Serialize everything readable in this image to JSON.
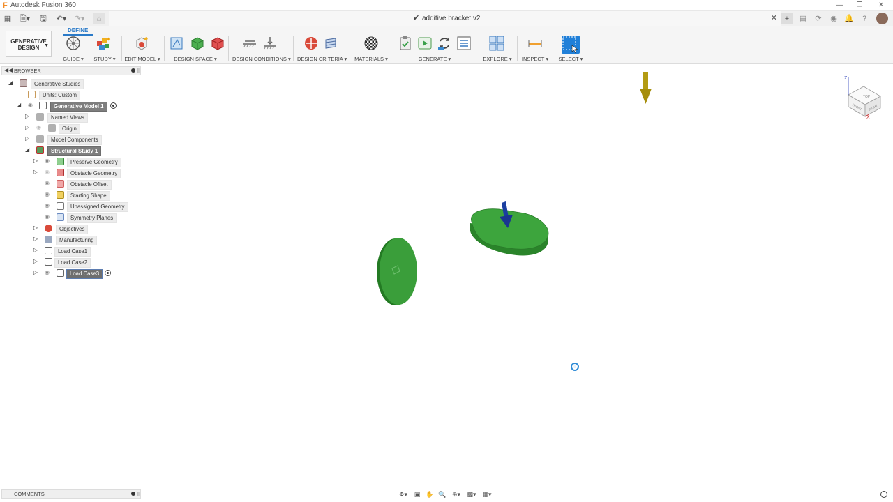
{
  "window": {
    "app_title": "Autodesk Fusion 360",
    "doc_title": "additive bracket v2"
  },
  "workspace": {
    "label_line1": "GENERATIVE",
    "label_line2": "DESIGN"
  },
  "ribbon": {
    "active_tab": "DEFINE",
    "groups": {
      "guide": "GUIDE",
      "study": "STUDY",
      "edit_model": "EDIT MODEL",
      "design_space": "DESIGN SPACE",
      "design_conditions": "DESIGN CONDITIONS",
      "design_criteria": "DESIGN CRITERIA",
      "materials": "MATERIALS",
      "generate": "GENERATE",
      "explore": "EXPLORE",
      "inspect": "INSPECT",
      "select": "SELECT"
    }
  },
  "browser": {
    "title": "BROWSER",
    "items": {
      "generative_studies": "Generative Studies",
      "units": "Units: Custom",
      "generative_model": "Generative Model 1",
      "named_views": "Named Views",
      "origin": "Origin",
      "model_components": "Model Components",
      "structural_study": "Structural Study 1",
      "preserve_geometry": "Preserve Geometry",
      "obstacle_geometry": "Obstacle Geometry",
      "obstacle_offset": "Obstacle Offset",
      "starting_shape": "Starting Shape",
      "unassigned_geometry": "Unassigned Geometry",
      "symmetry_planes": "Symmetry Planes",
      "objectives": "Objectives",
      "manufacturing": "Manufacturing",
      "load_case1": "Load Case1",
      "load_case2": "Load Case2",
      "load_case3": "Load Case3"
    }
  },
  "comments": {
    "title": "COMMENTS"
  },
  "viewcube": {
    "top": "TOP",
    "front": "FRONT",
    "right": "RIGHT",
    "axis_z": "Z",
    "axis_x": "X"
  },
  "colors": {
    "preserve_green": "#3a9e3a",
    "load_arrow_gold": "#b8a010",
    "load_arrow_blue": "#1b3fa0",
    "accent_blue": "#2a7ac8"
  }
}
